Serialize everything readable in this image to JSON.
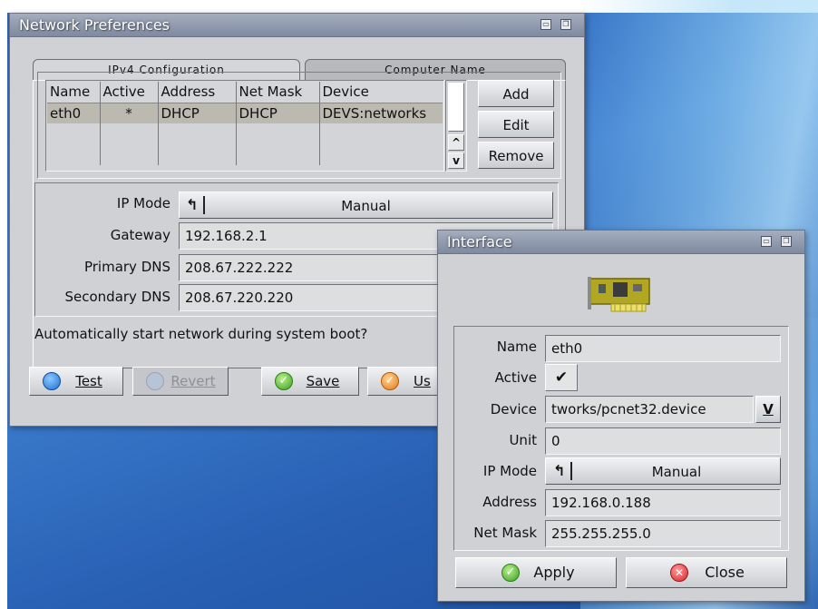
{
  "main_window": {
    "title": "Network Preferences",
    "tabs": [
      "IPv4 Configuration",
      "Computer Name"
    ],
    "table": {
      "columns": [
        "Name",
        "Active",
        "Address",
        "Net Mask",
        "Device"
      ],
      "rows": [
        [
          "eth0",
          "*",
          "DHCP",
          "DHCP",
          "DEVS:networks"
        ]
      ]
    },
    "side_buttons": {
      "add": "Add",
      "edit": "Edit",
      "remove": "Remove"
    },
    "ip_mode_label": "IP Mode",
    "ip_mode_value": "Manual",
    "gateway_label": "Gateway",
    "gateway_value": "192.168.2.1",
    "primary_dns_label": "Primary DNS",
    "primary_dns_value": "208.67.222.222",
    "secondary_dns_label": "Secondary DNS",
    "secondary_dns_value": "208.67.220.220",
    "autostart_question": "Automatically start network during system boot?",
    "buttons": {
      "test": "Test",
      "revert": "Revert",
      "save": "Save",
      "use": "Us"
    }
  },
  "interface_window": {
    "title": "Interface",
    "name_label": "Name",
    "name_value": "eth0",
    "active_label": "Active",
    "active_checked": true,
    "device_label": "Device",
    "device_value": "tworks/pcnet32.device",
    "unit_label": "Unit",
    "unit_value": "0",
    "ip_mode_label": "IP Mode",
    "ip_mode_value": "Manual",
    "address_label": "Address",
    "address_value": "192.168.0.188",
    "netmask_label": "Net Mask",
    "netmask_value": "255.255.255.0",
    "buttons": {
      "apply": "Apply",
      "close": "Close"
    }
  },
  "colors": {
    "desktop": "#2c63b8",
    "window_bg": "#cfd1d5",
    "selected_row": "#bcb9b0"
  }
}
